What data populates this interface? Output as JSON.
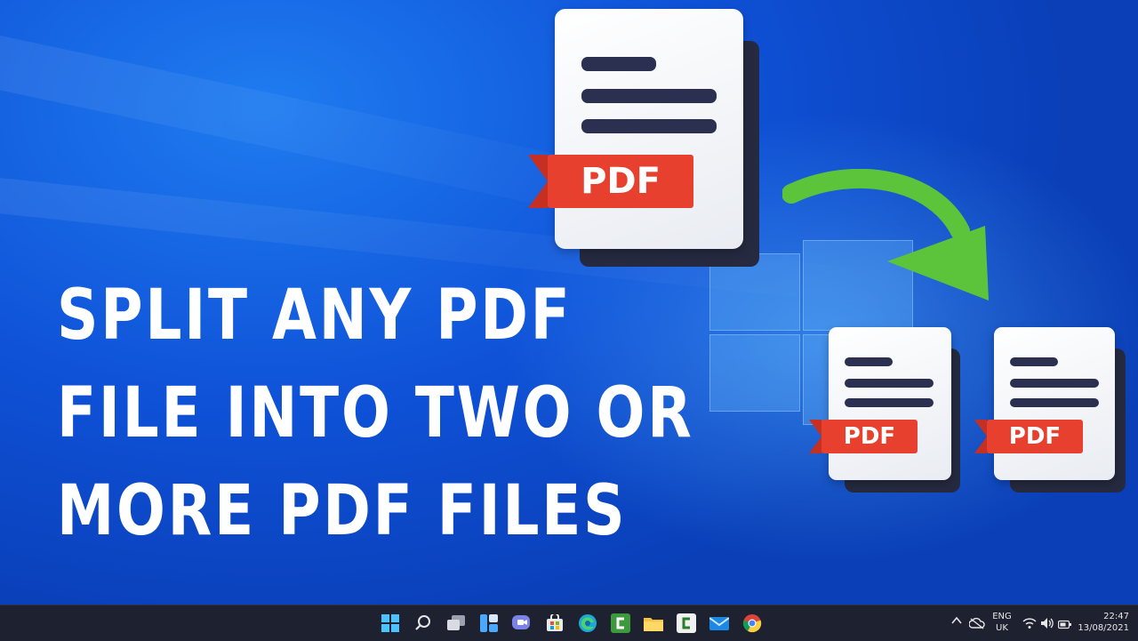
{
  "headline": {
    "line1": "SPLIT ANY PDF",
    "line2": "FILE INTO TWO OR",
    "line3": "MORE PDF FILES"
  },
  "documents": {
    "main_label": "PDF",
    "split1_label": "PDF",
    "split2_label": "PDF"
  },
  "taskbar": {
    "pinned_icons": [
      "windows-start-icon",
      "search-icon",
      "task-view-icon",
      "widgets-icon",
      "teams-chat-icon",
      "store-icon",
      "edge-icon",
      "camtasia-icon",
      "file-explorer-icon",
      "camtasia-recorder-icon",
      "mail-icon",
      "chrome-icon"
    ]
  },
  "tray": {
    "language": "ENG",
    "region": "UK",
    "time": "22:47",
    "date": "13/08/2021"
  },
  "colors": {
    "desktop_blue": "#0f52d8",
    "taskbar": "#1e2230",
    "ribbon_red": "#e8402f",
    "arrow_green": "#5cc43a"
  }
}
